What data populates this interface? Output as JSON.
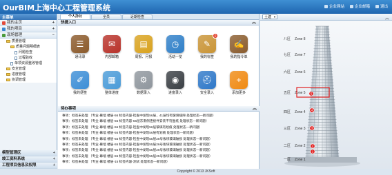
{
  "header": {
    "title": "OurBIM上海中心工程管理系统",
    "links": [
      "企业网站",
      "企业邮箱",
      "退出"
    ]
  },
  "sidebar": {
    "title": "主菜单",
    "items": [
      {
        "label": "我的主页",
        "sign": "+"
      },
      {
        "label": "我的项目",
        "sign": "+"
      },
      {
        "label": "现场管理",
        "sign": "−"
      }
    ],
    "tree": [
      {
        "label": "质量管理",
        "type": "folder",
        "indent": 1
      },
      {
        "label": "质量问题明细表",
        "type": "folder",
        "indent": 2
      },
      {
        "label": "问题检查",
        "type": "doc",
        "indent": 3
      },
      {
        "label": "过程验收",
        "type": "doc",
        "indent": 3
      },
      {
        "label": "单项资源整改管理",
        "type": "doc",
        "indent": 2
      },
      {
        "label": "安全管理",
        "type": "folder",
        "indent": 1
      },
      {
        "label": "进度管理",
        "type": "folder",
        "indent": 1
      },
      {
        "label": "协调管理",
        "type": "folder",
        "indent": 1
      }
    ],
    "bottom": [
      {
        "label": "模型管理区",
        "sign": "+"
      },
      {
        "label": "竣工资料系统",
        "sign": "+"
      },
      {
        "label": "工程项目信息及权限",
        "sign": "+"
      }
    ]
  },
  "tabs": [
    "个人办公",
    "全员",
    "近期检查"
  ],
  "quick": {
    "title": "快捷入口",
    "items": [
      {
        "label": "通讯录",
        "icon": "address-book-icon",
        "color": "#8b5a2b",
        "glyph": "☰"
      },
      {
        "label": "内部邮箱",
        "icon": "mail-icon",
        "color": "#b8322a",
        "glyph": "✉"
      },
      {
        "label": "周报、月报",
        "icon": "report-icon",
        "color": "#d9a21e",
        "glyph": "▤"
      },
      {
        "label": "活动一览",
        "icon": "activity-icon",
        "color": "#2f7fc8",
        "glyph": "◷"
      },
      {
        "label": "我的标签",
        "icon": "tag-icon",
        "color": "#c99436",
        "glyph": "✎",
        "badge": "0"
      },
      {
        "label": "我的指令单",
        "icon": "order-icon",
        "color": "#8a5c2e",
        "glyph": "✍"
      },
      {
        "label": "我的便签",
        "icon": "note-icon",
        "color": "#3d8ed6",
        "glyph": "✐"
      },
      {
        "label": "整体进度",
        "icon": "schedule-icon",
        "color": "#4a9bd8",
        "glyph": "▦"
      },
      {
        "label": "数据录入",
        "icon": "data-entry-icon",
        "color": "#8f969d",
        "glyph": "⚙"
      },
      {
        "label": "进度录入",
        "icon": "progress-entry-icon",
        "color": "#3a3f44",
        "glyph": "◉"
      },
      {
        "label": "安全录入",
        "icon": "safety-entry-icon",
        "color": "#2f78c8",
        "glyph": "⛑"
      },
      {
        "label": "添加更多",
        "icon": "plus-icon",
        "color": "#f08a12",
        "glyph": "+"
      }
    ]
  },
  "notices": {
    "title": "待办事项",
    "items": [
      "事项：标签未处理 （专业-幕墙  楼层-56 标签内容-检查中发现56层，41层均有玻璃缝隙 处理状态—新问题）",
      "事项：标签未处理 （专业-幕墙  楼层-56 标签内容-56层东南侧连接件安装不符图纸 处理状态—新问题）",
      "事项：标签未处理 （专业-幕墙  楼层-56 标签内容-检查中发现56层玻璃有划痕 处理状态—新问题）",
      "事项：标签未处理 （专业-幕墙  楼层-56 标签内容-检查中发现56层有划痕 处理状态—新问题）",
      "事项：标签未处理 （专业-幕墙  楼层-55 标签内容-检查中发现55层25号板块玻璃破损 处理状态—新问题）",
      "事项：标签未处理 （专业-幕墙  楼层-55 标签内容-检查中发现55层26号板块玻璃破损 处理状态—新问题）",
      "事项：标签未处理 （专业-幕墙  楼层-55 标签内容-检查中发现55层26号板块玻璃破损 处理状态—新问题）",
      "事项：标签未处理 （专业-幕墙  楼层-55 标签内容-检查中发现55层25号板块玻璃破损 处理状态—新问题）",
      "事项：标签未处理 （专业-幕墙  楼层-15 标签内容-测试 处理状态—新问题）"
    ]
  },
  "model": {
    "select_value": "土建",
    "zones": [
      {
        "name": "八区",
        "label": "Zone 8"
      },
      {
        "name": "七区",
        "label": "Zone 7"
      },
      {
        "name": "六区",
        "label": "Zone 6"
      },
      {
        "name": "五区",
        "label": "Zone 5"
      },
      {
        "name": "四区",
        "label": "Zone 4"
      },
      {
        "name": "三区",
        "label": "Zone 3"
      },
      {
        "name": "二区",
        "label": "Zone 2"
      },
      {
        "name": "一区",
        "label": "Zone 1"
      }
    ],
    "markers": [
      "5",
      "4",
      "3",
      "2",
      "1"
    ],
    "highlight_color": "#e02020"
  },
  "footer": "Copyright © 2013 JKSoft"
}
